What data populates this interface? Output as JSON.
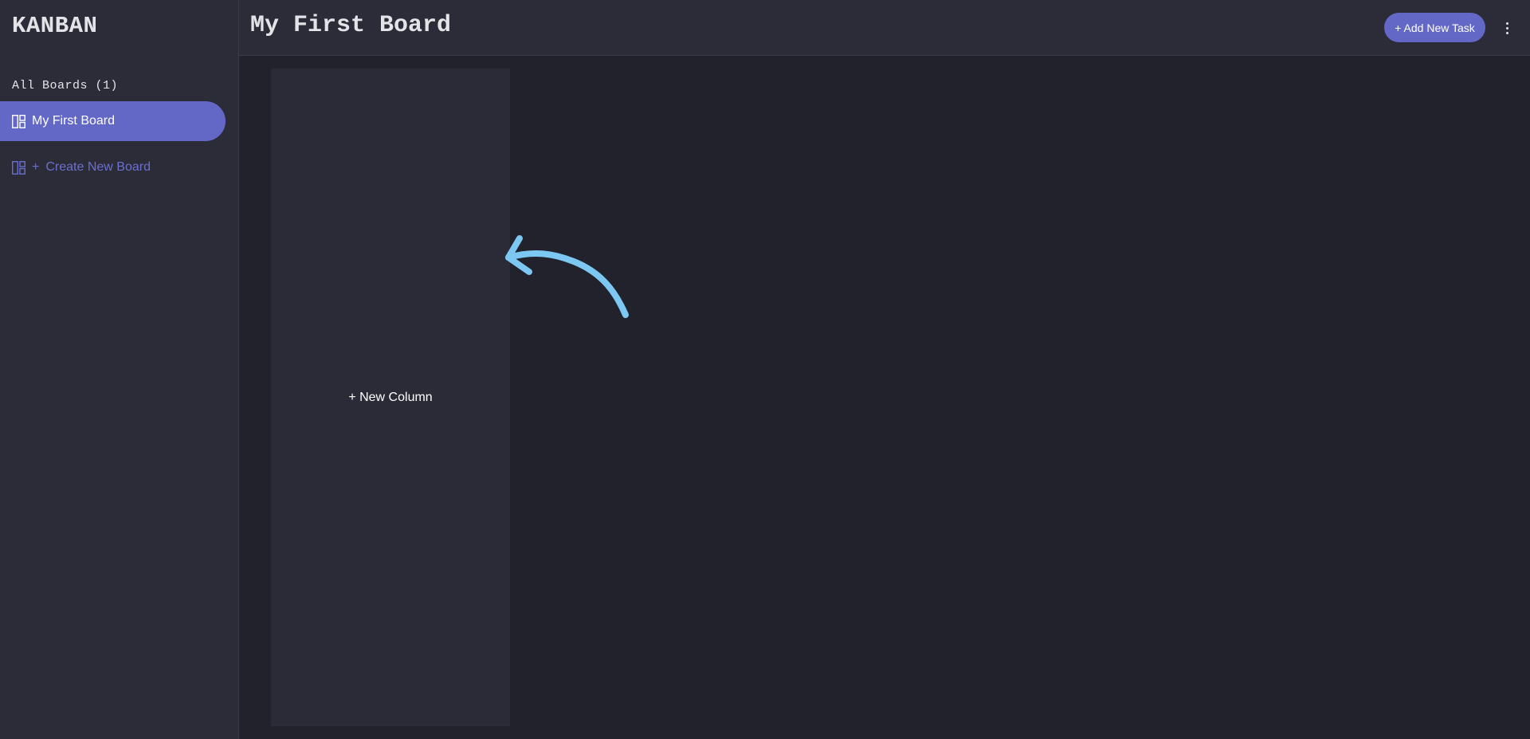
{
  "app": {
    "logo": "KANBAN"
  },
  "sidebar": {
    "heading": "All Boards (1)",
    "boards": [
      {
        "label": "My First Board",
        "active": true,
        "icon": "board-icon"
      }
    ],
    "create": {
      "plus": "+",
      "label": "Create New Board",
      "icon": "board-icon"
    }
  },
  "header": {
    "title": "My First Board",
    "add_task_label": "+ Add New Task",
    "menu_icon": "kebab-menu-icon"
  },
  "board": {
    "new_column_label": "+ New Column",
    "hint_icon": "curved-arrow-icon"
  },
  "colors": {
    "accent": "#6368c7",
    "accent_text": "#6a6fce",
    "sidebar_bg": "#2c2c38",
    "board_bg": "#21222c",
    "column_bg": "#2a2b36",
    "arrow": "#7cc8f2"
  }
}
